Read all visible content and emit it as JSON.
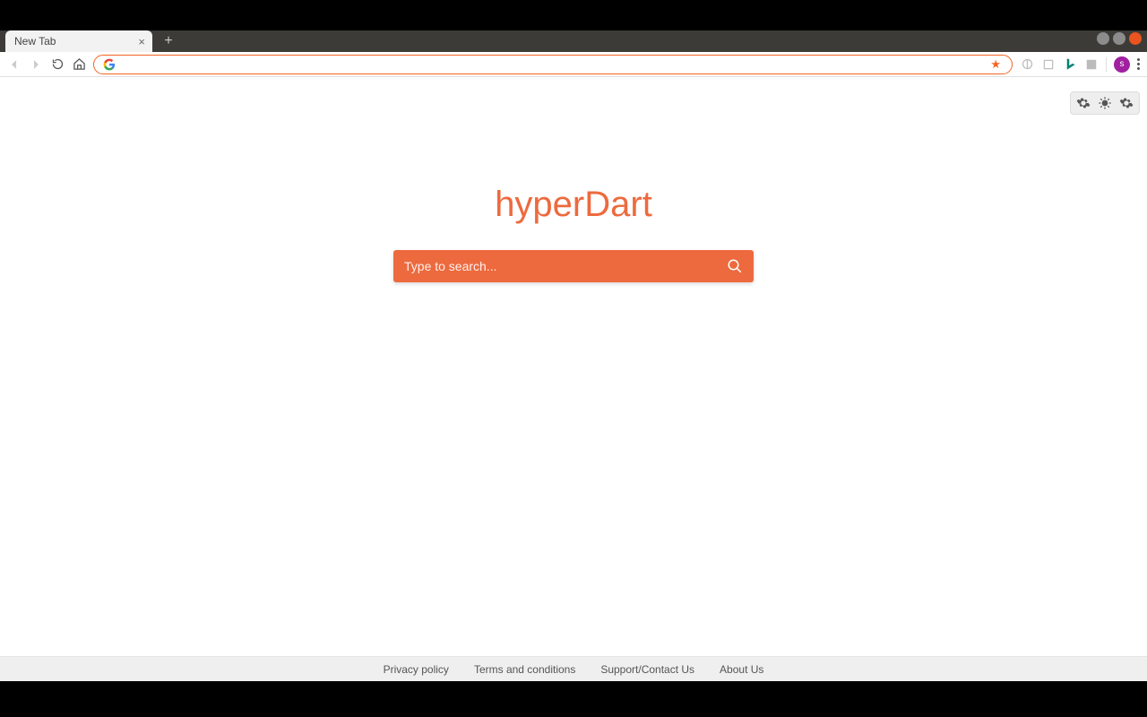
{
  "window": {
    "controls": [
      "min",
      "max",
      "close"
    ]
  },
  "tabs": {
    "active_label": "New Tab"
  },
  "nav": {
    "address_value": ""
  },
  "avatar": {
    "initial": "s"
  },
  "page": {
    "logo": "hyperDart",
    "search_placeholder": "Type to search..."
  },
  "footer": {
    "links": [
      "Privacy policy",
      "Terms and conditions",
      "Support/Contact Us",
      "About Us"
    ]
  }
}
